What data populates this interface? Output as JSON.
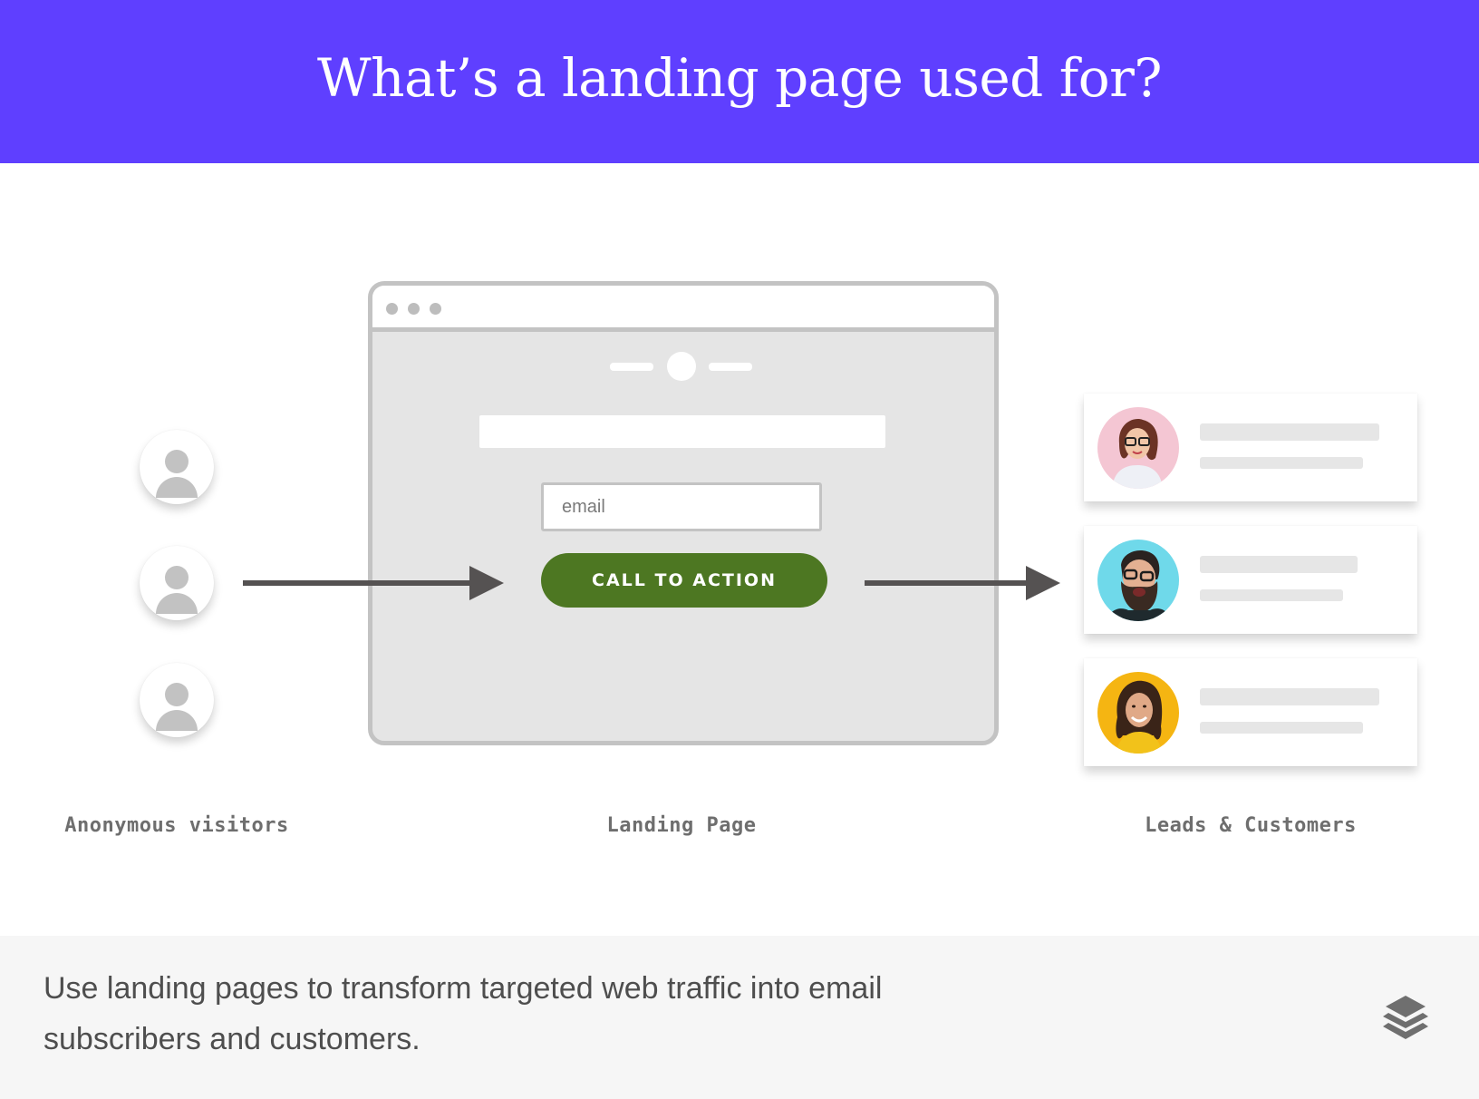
{
  "header": {
    "title": "What’s a landing page used for?",
    "background_color": "#5f3fff"
  },
  "visitors": {
    "count": 3,
    "icon": "user-silhouette-icon",
    "caption": "Anonymous visitors"
  },
  "landing_page": {
    "window_controls": [
      "dot",
      "dot",
      "dot"
    ],
    "email_placeholder": "email",
    "cta_label": "CALL TO ACTION",
    "cta_color": "#4d7722",
    "caption": "Landing Page"
  },
  "leads": {
    "caption": "Leads & Customers",
    "items": [
      {
        "avatar": "woman-with-glasses-photo",
        "avatar_bg": "#f4c6d3"
      },
      {
        "avatar": "bearded-man-with-glasses-photo",
        "avatar_bg": "#6fd9ea"
      },
      {
        "avatar": "smiling-woman-photo",
        "avatar_bg": "#f5b512"
      }
    ]
  },
  "footer": {
    "text": "Use landing pages to transform targeted web traffic into email subscribers and customers.",
    "logo": "stacked-layers-logo"
  }
}
